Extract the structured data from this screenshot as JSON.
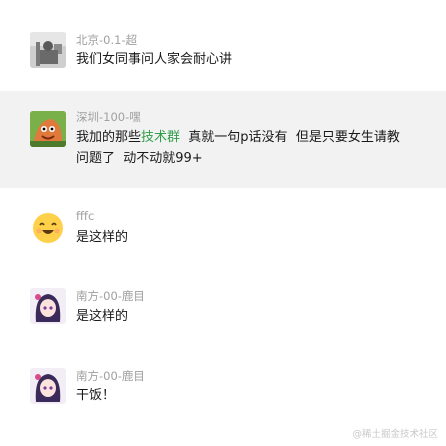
{
  "messages": [
    {
      "sender": "北京-0.1-超",
      "text": "我们女同事问人家会耐心讲"
    },
    {
      "sender": "深圳-100-嘿",
      "line1_before": "我加的那些",
      "line1_link": "技术群",
      "line1_after": "  真就一句p话没有  但是只要女生请教",
      "line2": "问题了  动不动就99+"
    },
    {
      "sender": "fffc",
      "text": "是这样的"
    },
    {
      "sender": "南方-00-鹿目",
      "text": "是这样的"
    },
    {
      "sender": "南方-00-鹿目",
      "text": "干饭！"
    }
  ],
  "watermark": "@稀土掘金技术社区",
  "colors": {
    "highlight": "#f2f2f2",
    "link": "#2f9e48",
    "sender": "#a0a0a0"
  }
}
